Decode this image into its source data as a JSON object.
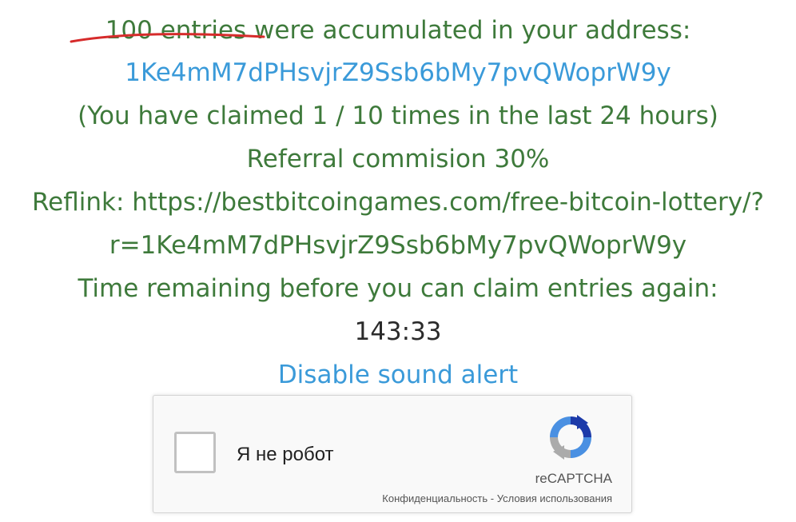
{
  "claim_summary": {
    "entries_count": "100 entries",
    "accumulated_text": " were accumulated in your address:",
    "address": "1Ke4mM7dPHsvjrZ9Ssb6bMy7pvQWoprW9y",
    "claims_info": "(You have claimed 1 / 10 times in the last 24 hours)",
    "referral_commission": "Referral commision 30%",
    "reflink_line1": "Reflink: https://bestbitcoingames.com/free-bitcoin-lottery/?",
    "reflink_line2": "r=1Ke4mM7dPHsvjrZ9Ssb6bMy7pvQWoprW9y",
    "time_remaining_label": "Time remaining before you can claim entries again:",
    "timer_value": "143:33",
    "sound_toggle": "Disable sound alert"
  },
  "recaptcha": {
    "checkbox_label": "Я не робот",
    "brand": "reCAPTCHA",
    "privacy_link": "Конфиденциальность",
    "separator": " - ",
    "terms_link": "Условия использования",
    "logo_icon": "recaptcha-logo-icon"
  },
  "colors": {
    "text_green": "#3e7a3b",
    "link_blue": "#3a9ad9",
    "annotation_red": "#d62b2b"
  }
}
